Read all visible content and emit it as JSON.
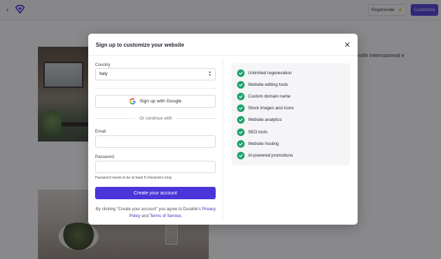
{
  "topbar": {
    "regenerate_label": "Regenerate",
    "customize_label": "Customize"
  },
  "background": {
    "partial_text": "ealth internazionali e"
  },
  "modal": {
    "title": "Sign up to customize your website",
    "country": {
      "label": "Country",
      "value": "Italy"
    },
    "google_button": "Sign up with Google",
    "or_text": "Or continue with",
    "email": {
      "label": "Email",
      "value": "",
      "placeholder": ""
    },
    "password": {
      "label": "Password",
      "value": "",
      "placeholder": "",
      "hint": "Password needs to be at least 8 characters long"
    },
    "create_button": "Create your account",
    "terms": {
      "prefix": "By clicking \"Create your account\" you agree to Durable's",
      "privacy_link": "Privacy Policy",
      "and_text": "and",
      "terms_link": "Terms of Service",
      "suffix": "."
    },
    "features": [
      {
        "label": "Unlimited regeneration",
        "icon": "check-circle-icon"
      },
      {
        "label": "Website editing tools",
        "icon": "check-circle-icon"
      },
      {
        "label": "Custom domain name",
        "icon": "check-circle-icon"
      },
      {
        "label": "Stock images and icons",
        "icon": "check-circle-icon"
      },
      {
        "label": "Website analytics",
        "icon": "check-circle-icon"
      },
      {
        "label": "SEO tools",
        "icon": "check-circle-icon"
      },
      {
        "label": "Website hosting",
        "icon": "check-circle-icon"
      },
      {
        "label": "AI-powered promotions",
        "icon": "check-circle-icon"
      }
    ]
  },
  "colors": {
    "accent": "#4a35d8",
    "check": "#20a36b",
    "link": "#3b2db8"
  }
}
